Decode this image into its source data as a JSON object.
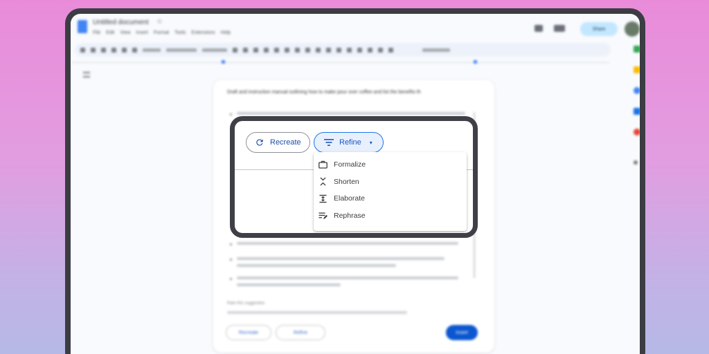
{
  "docs": {
    "title": "Untitled document",
    "menus": [
      "File",
      "Edit",
      "View",
      "Insert",
      "Format",
      "Tools",
      "Extensions",
      "Help"
    ],
    "share_label": "Share",
    "editing_label": "Editing"
  },
  "ai_panel": {
    "prompt": "Draft and instruction manual outlining how to make pour over coffee and list the benefits th",
    "rate_label": "Rate this suggestion",
    "recreate_label": "Recreate",
    "refine_label": "Refine",
    "insert_label": "Insert"
  },
  "highlight": {
    "recreate_label": "Recreate",
    "refine_label": "Refine",
    "refine_caret": "▾",
    "menu_items": [
      {
        "label": "Formalize",
        "icon": "briefcase-icon"
      },
      {
        "label": "Shorten",
        "icon": "shorten-icon"
      },
      {
        "label": "Elaborate",
        "icon": "elaborate-icon"
      },
      {
        "label": "Rephrase",
        "icon": "rephrase-icon"
      }
    ]
  },
  "colors": {
    "accent": "#1a73e8",
    "frame": "#3f4047",
    "background_top": "#e98bd9",
    "background_bottom": "#b6b9e6"
  }
}
